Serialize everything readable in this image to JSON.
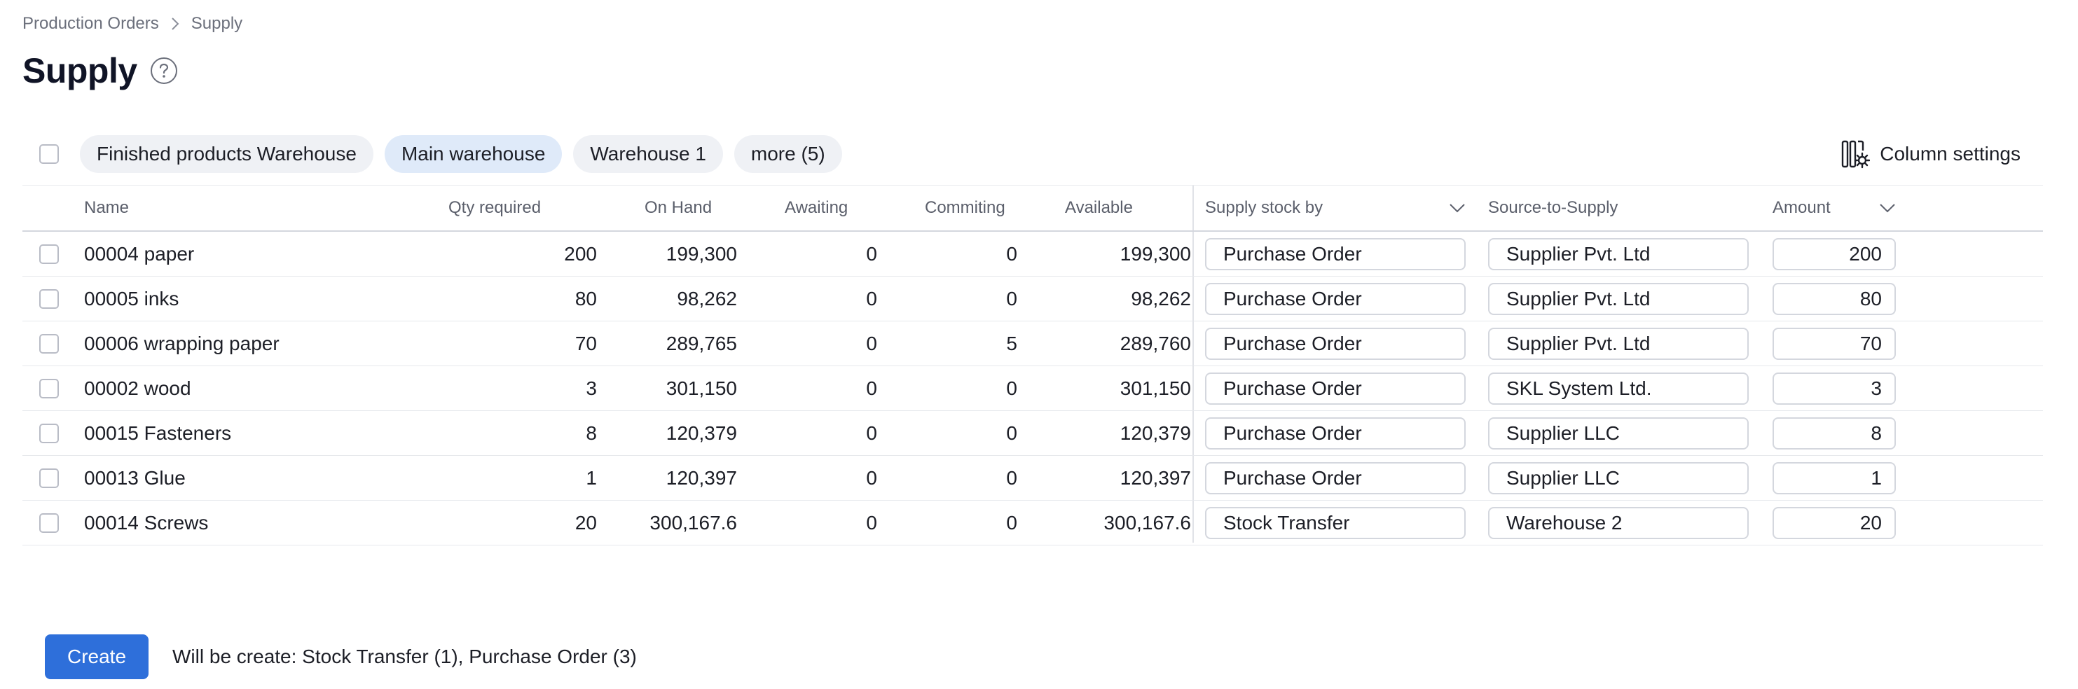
{
  "breadcrumb": {
    "parent": "Production Orders",
    "current": "Supply"
  },
  "page": {
    "title": "Supply"
  },
  "filters": {
    "chips": [
      "Finished products Warehouse",
      "Main warehouse",
      "Warehouse 1",
      "more (5)"
    ],
    "active": "Main warehouse",
    "column_settings_label": "Column settings"
  },
  "table": {
    "headers": {
      "name": "Name",
      "qty_required": "Qty required",
      "on_hand": "On Hand",
      "awaiting": "Awaiting",
      "commiting": "Commiting",
      "available": "Available",
      "supply_stock_by": "Supply stock by",
      "source_to_supply": "Source-to-Supply",
      "amount": "Amount"
    },
    "rows": [
      {
        "name": "00004 paper",
        "qty_required": "200",
        "on_hand": "199,300",
        "awaiting": "0",
        "commiting": "0",
        "available": "199,300",
        "supply_stock_by": "Purchase Order",
        "source": "Supplier Pvt. Ltd",
        "amount": "200"
      },
      {
        "name": "00005 inks",
        "qty_required": "80",
        "on_hand": "98,262",
        "awaiting": "0",
        "commiting": "0",
        "available": "98,262",
        "supply_stock_by": "Purchase Order",
        "source": "Supplier Pvt. Ltd",
        "amount": "80"
      },
      {
        "name": "00006 wrapping paper",
        "qty_required": "70",
        "on_hand": "289,765",
        "awaiting": "0",
        "commiting": "5",
        "available": "289,760",
        "supply_stock_by": "Purchase Order",
        "source": "Supplier Pvt. Ltd",
        "amount": "70"
      },
      {
        "name": "00002 wood",
        "qty_required": "3",
        "on_hand": "301,150",
        "awaiting": "0",
        "commiting": "0",
        "available": "301,150",
        "supply_stock_by": "Purchase Order",
        "source": "SKL System Ltd.",
        "amount": "3"
      },
      {
        "name": "00015 Fasteners",
        "qty_required": "8",
        "on_hand": "120,379",
        "awaiting": "0",
        "commiting": "0",
        "available": "120,379",
        "supply_stock_by": "Purchase Order",
        "source": "Supplier LLC",
        "amount": "8"
      },
      {
        "name": "00013 Glue",
        "qty_required": "1",
        "on_hand": "120,397",
        "awaiting": "0",
        "commiting": "0",
        "available": "120,397",
        "supply_stock_by": "Purchase Order",
        "source": "Supplier LLC",
        "amount": "1"
      },
      {
        "name": "00014 Screws",
        "qty_required": "20",
        "on_hand": "300,167.6",
        "awaiting": "0",
        "commiting": "0",
        "available": "300,167.6",
        "supply_stock_by": "Stock Transfer",
        "source": "Warehouse 2",
        "amount": "20"
      }
    ]
  },
  "footer": {
    "create_label": "Create",
    "summary": "Will be create: Stock Transfer (1), Purchase Order (3)"
  },
  "colors": {
    "primary": "#2e6fda",
    "chip_active": "#dfeaf9",
    "chip": "#eff1f5"
  },
  "icons": [
    "chevron-right-icon",
    "help-circle-icon",
    "column-settings-icon",
    "chevron-down-icon"
  ]
}
